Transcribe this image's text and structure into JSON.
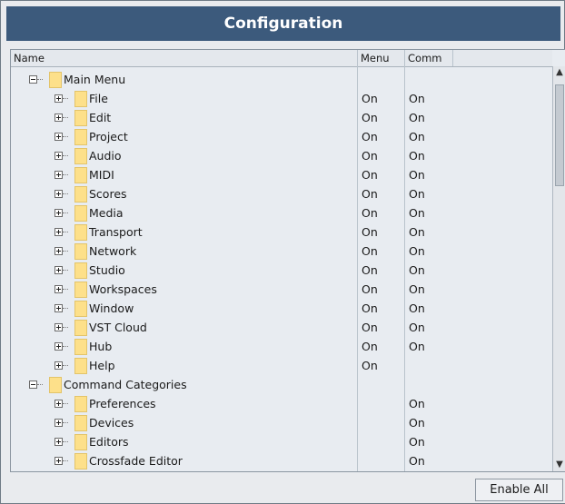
{
  "window": {
    "title": "Configuration"
  },
  "table": {
    "columns": {
      "name": "Name",
      "menu": "Menu",
      "commands": "Comm"
    },
    "rows": [
      {
        "name": "Main Menu",
        "menu": "",
        "cmd": ""
      },
      {
        "name": "File",
        "menu": "On",
        "cmd": "On"
      },
      {
        "name": "Edit",
        "menu": "On",
        "cmd": "On"
      },
      {
        "name": "Project",
        "menu": "On",
        "cmd": "On"
      },
      {
        "name": "Audio",
        "menu": "On",
        "cmd": "On"
      },
      {
        "name": "MIDI",
        "menu": "On",
        "cmd": "On"
      },
      {
        "name": "Scores",
        "menu": "On",
        "cmd": "On"
      },
      {
        "name": "Media",
        "menu": "On",
        "cmd": "On"
      },
      {
        "name": "Transport",
        "menu": "On",
        "cmd": "On"
      },
      {
        "name": "Network",
        "menu": "On",
        "cmd": "On"
      },
      {
        "name": "Studio",
        "menu": "On",
        "cmd": "On"
      },
      {
        "name": "Workspaces",
        "menu": "On",
        "cmd": "On"
      },
      {
        "name": "Window",
        "menu": "On",
        "cmd": "On"
      },
      {
        "name": "VST Cloud",
        "menu": "On",
        "cmd": "On"
      },
      {
        "name": "Hub",
        "menu": "On",
        "cmd": "On"
      },
      {
        "name": "Help",
        "menu": "On",
        "cmd": ""
      },
      {
        "name": "Command Categories",
        "menu": "",
        "cmd": ""
      },
      {
        "name": "Preferences",
        "menu": "",
        "cmd": "On"
      },
      {
        "name": "Devices",
        "menu": "",
        "cmd": "On"
      },
      {
        "name": "Editors",
        "menu": "",
        "cmd": "On"
      },
      {
        "name": "Crossfade Editor",
        "menu": "",
        "cmd": "On"
      }
    ]
  },
  "footer": {
    "enable_all": "Enable All"
  },
  "icons": {
    "folder": "folder-icon",
    "expander": "tree-expander-icon",
    "scroll_up": "chevron-up-icon",
    "scroll_down": "chevron-down-icon"
  },
  "colors": {
    "titlebar": "#3c5a7c",
    "folder": "#fde08a"
  }
}
